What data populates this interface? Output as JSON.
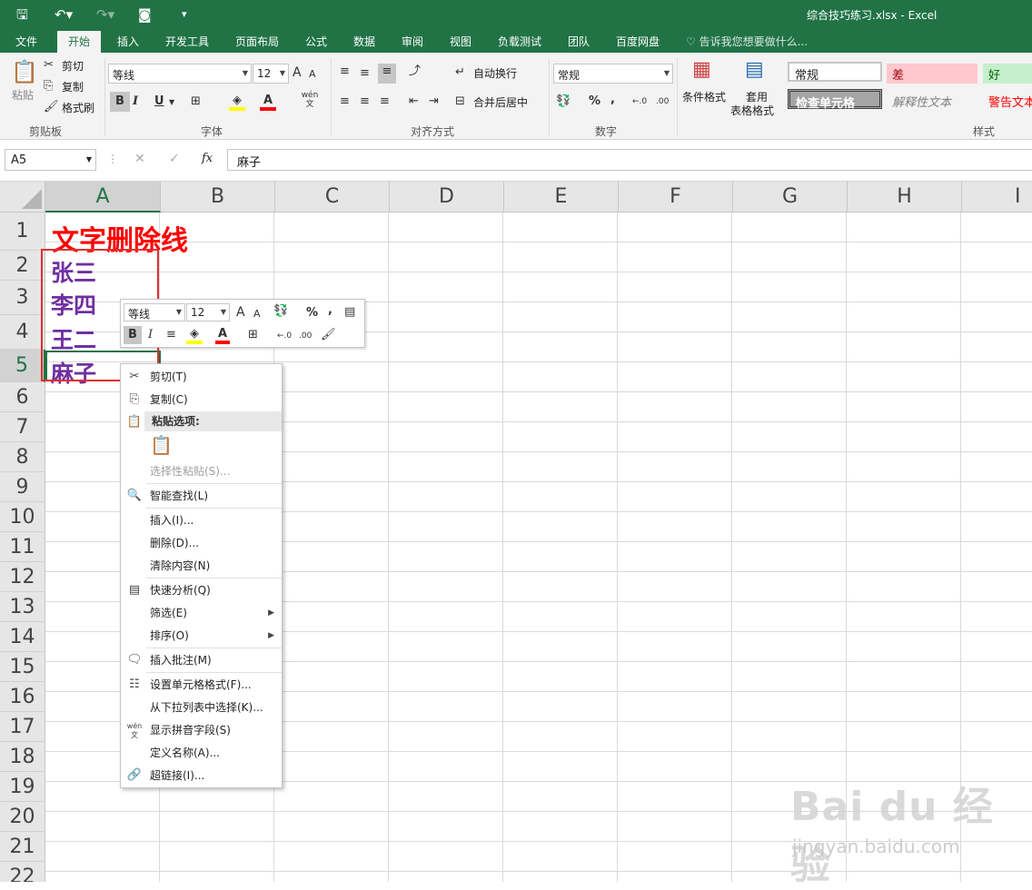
{
  "app": {
    "title": "综合技巧练习.xlsx  -  Excel",
    "qat": {
      "save": "save-icon",
      "undo": "undo-icon",
      "redo": "redo-icon",
      "camera": "camera-icon",
      "customize": "▾"
    }
  },
  "tabs": [
    "文件",
    "开始",
    "插入",
    "开发工具",
    "页面布局",
    "公式",
    "数据",
    "审阅",
    "视图",
    "负载测试",
    "团队",
    "百度网盘"
  ],
  "active_tab": "开始",
  "tell_me": "告诉我您想要做什么...",
  "ribbon": {
    "clipboard": {
      "paste": "粘贴",
      "cut": "剪切",
      "copy": "复制",
      "format_painter": "格式刷",
      "label": "剪贴板"
    },
    "font": {
      "name": "等线",
      "size": "12",
      "label": "字体",
      "bold": "B",
      "italic": "I",
      "underline": "U",
      "grow": "A",
      "shrink": "A",
      "phonetic": "wén 文"
    },
    "alignment": {
      "wrap": "自动换行",
      "merge": "合并后居中",
      "label": "对齐方式"
    },
    "number": {
      "format": "常规",
      "percent": "%",
      "comma": ",",
      "label": "数字"
    },
    "styles": {
      "conditional": "条件格式",
      "table_l1": "套用",
      "table_l2": "表格格式",
      "label": "样式",
      "normal": "常规",
      "bad": "差",
      "good": "好",
      "check_cell": "检查单元格",
      "explanatory": "解释性文本",
      "warning": "警告文本"
    }
  },
  "formula_bar": {
    "name_box": "A5",
    "cancel": "✕",
    "enter": "✓",
    "fx": "fx",
    "content": "麻子"
  },
  "columns": [
    "A",
    "B",
    "C",
    "D",
    "E",
    "F",
    "G",
    "H",
    "I"
  ],
  "rows": [
    "1",
    "2",
    "3",
    "4",
    "5",
    "6",
    "7",
    "8",
    "9",
    "10",
    "11",
    "12",
    "13",
    "14",
    "15",
    "16",
    "17",
    "18",
    "19",
    "20",
    "21",
    "22"
  ],
  "cells": {
    "A1": "文字删除线",
    "A2": "张三",
    "A3": "李四",
    "A4": "王二",
    "A5": "麻子"
  },
  "colors": {
    "excel_green": "#217346",
    "title_red": "#ff0000",
    "name_purple": "#7030a0",
    "box_red": "#e03030"
  },
  "mini_toolbar": {
    "font": "等线",
    "size": "12",
    "grow": "A",
    "shrink": "A",
    "percent": "%",
    "comma": ",",
    "bold": "B",
    "italic": "I",
    "font_color": "A"
  },
  "context_menu": {
    "cut": "剪切(T)",
    "copy": "复制(C)",
    "paste_header": "粘贴选项:",
    "paste_special": "选择性粘贴(S)...",
    "smart_lookup": "智能查找(L)",
    "insert": "插入(I)...",
    "delete": "删除(D)...",
    "clear": "清除内容(N)",
    "quick_analysis": "快速分析(Q)",
    "filter": "筛选(E)",
    "sort": "排序(O)",
    "insert_comment": "插入批注(M)",
    "format_cells": "设置单元格格式(F)...",
    "pick_list": "从下拉列表中选择(K)...",
    "phonetic": "显示拼音字段(S)",
    "define_name": "定义名称(A)...",
    "hyperlink": "超链接(I)..."
  },
  "watermark": {
    "logo": "Bai du 经验",
    "url": "jingyan.baidu.com"
  }
}
